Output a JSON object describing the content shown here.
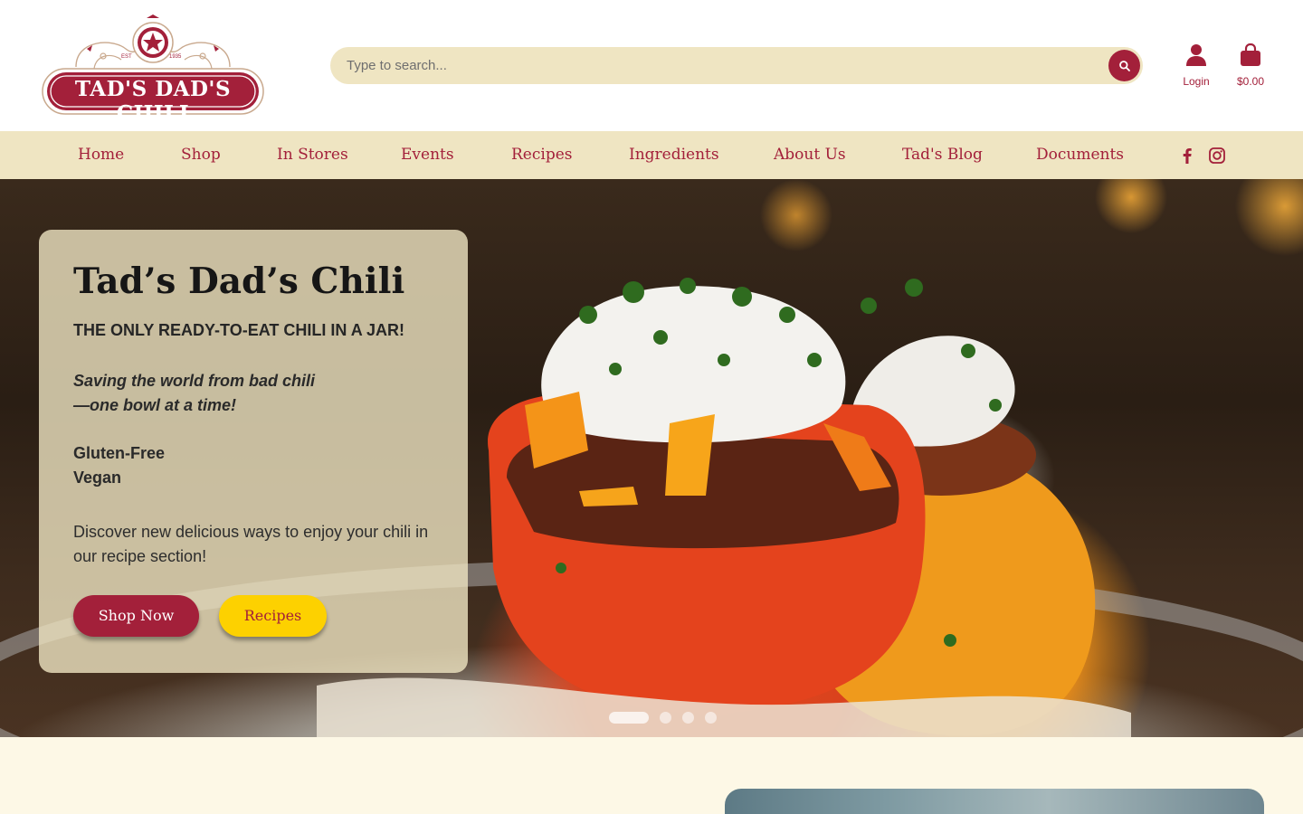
{
  "brand": {
    "logo_text": "TAD'S DAD'S CHILI",
    "logo_est": "EST",
    "logo_year": "1935",
    "colors": {
      "primary": "#a3203a",
      "cream": "#efe5c2",
      "yellow": "#fdd100"
    }
  },
  "header": {
    "search_placeholder": "Type to search...",
    "search_icon": "search-icon",
    "login_label": "Login",
    "cart_total": "$0.00"
  },
  "nav": {
    "items": [
      {
        "label": "Home"
      },
      {
        "label": "Shop"
      },
      {
        "label": "In Stores"
      },
      {
        "label": "Events"
      },
      {
        "label": "Recipes"
      },
      {
        "label": "Ingredients"
      },
      {
        "label": "About Us"
      },
      {
        "label": "Tad's Blog"
      },
      {
        "label": "Documents"
      }
    ],
    "social": [
      "facebook-icon",
      "instagram-icon"
    ]
  },
  "hero": {
    "title": "Tad’s Dad’s Chili",
    "tagline": "THE ONLY READY-TO-EAT CHILI IN A JAR!",
    "slogan_line1": "Saving the world from bad chili",
    "slogan_line2": "—one bowl at a time!",
    "feature1": "Gluten-Free",
    "feature2": "Vegan",
    "description": "Discover new delicious ways to enjoy your chili in our recipe section!",
    "shop_button": "Shop Now",
    "recipes_button": "Recipes",
    "slides_total": 4,
    "active_slide": 1
  }
}
